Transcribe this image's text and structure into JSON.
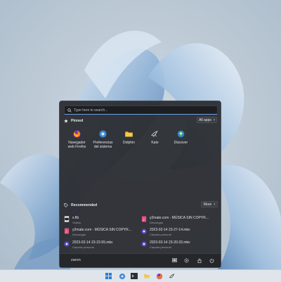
{
  "search": {
    "placeholder": "Type here to search..."
  },
  "pinned": {
    "title": "Pinned",
    "all_apps_label": "All apps",
    "apps": [
      {
        "label": "Navegador\nweb Firefox",
        "icon": "firefox-icon"
      },
      {
        "label": "Preferencias\ndel sistema",
        "icon": "settings-gear-icon"
      },
      {
        "label": "Dolphin",
        "icon": "folder-icon"
      },
      {
        "label": "Kate",
        "icon": "kate-bird-icon"
      },
      {
        "label": "Discover",
        "icon": "discover-icon"
      }
    ]
  },
  "recommended": {
    "title": "Recommended",
    "more_label": "More",
    "items": [
      {
        "title": "s.flb",
        "sub": "Videos",
        "icon": "film-file-icon"
      },
      {
        "title": "y2mate.com - MÚSICA SIN COPYR...",
        "sub": "Descargas",
        "icon": "audio-file-icon"
      },
      {
        "title": "y2mate.com - MÚSICA SIN COPYR...",
        "sub": "Descargas",
        "icon": "audio-file-icon"
      },
      {
        "title": "2023-02-14 23-27-14.mkv",
        "sub": "Carpeta personal",
        "icon": "video-file-icon"
      },
      {
        "title": "2023-02-14 23-23-55.mkv",
        "sub": "Carpeta personal",
        "icon": "video-file-icon"
      },
      {
        "title": "2023-02-14 23-20-32.mkv",
        "sub": "Carpeta personal",
        "icon": "video-file-icon"
      }
    ]
  },
  "footer": {
    "username": "zaron"
  },
  "colors": {
    "accent": "#6ea2e6",
    "menu_bg": "#2d2f33",
    "taskbar_bg": "#dfe5ea"
  }
}
